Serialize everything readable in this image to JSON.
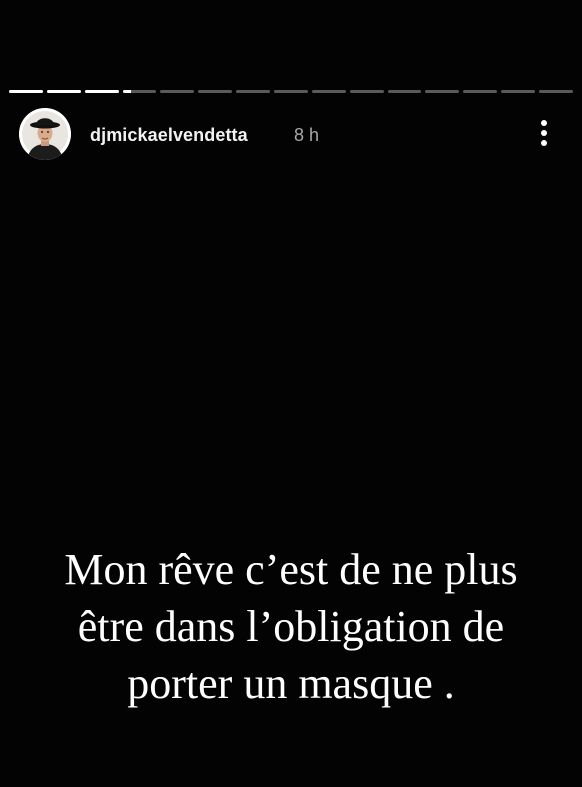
{
  "story": {
    "progress": [
      1,
      1,
      1,
      0.25,
      0,
      0,
      0,
      0,
      0,
      0,
      0,
      0,
      0,
      0,
      0
    ],
    "account": {
      "username": "djmickaelvendetta",
      "time": "8 h"
    },
    "caption_lines": [
      "Mon rêve c’est de ne plus",
      "être dans l’obligation de",
      "porter un masque ."
    ]
  },
  "colors": {
    "background": "#030303",
    "text": "#ffffff",
    "muted": "#a9a9a9"
  }
}
